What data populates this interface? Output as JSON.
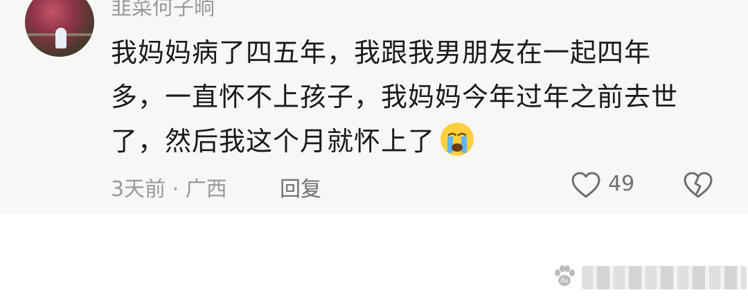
{
  "comment": {
    "username": "韭菜何子晌",
    "text_lines": [
      "我妈妈病了四五年，我跟我男朋友在一起四年",
      "多，一直怀不上孩子，我妈妈今年过年之前去世",
      "了，然后我这个月就怀上了"
    ],
    "emoji": "crying-face-icon",
    "time": "3天前",
    "separator": "·",
    "location": "广西",
    "reply_label": "回复",
    "like_count": "49"
  },
  "colors": {
    "card_bg": "#f7f7f5",
    "text": "#1a1a1a",
    "meta": "#999999",
    "icon_stroke": "#6e6e6e"
  }
}
